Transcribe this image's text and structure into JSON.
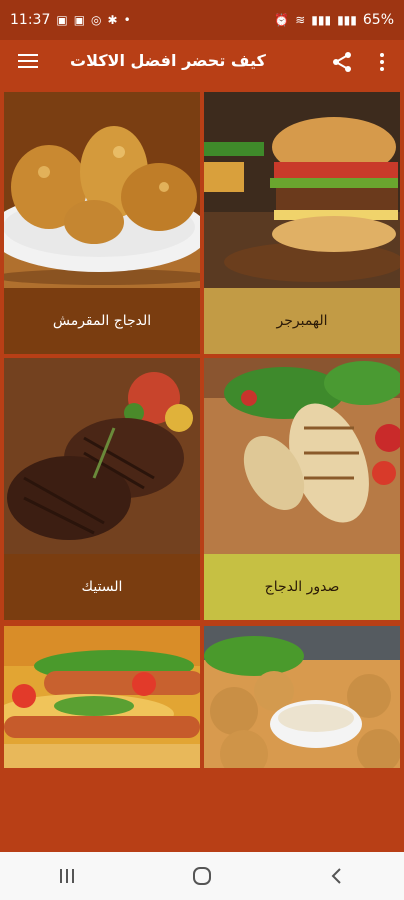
{
  "status_bar": {
    "time": "11:37",
    "battery": "65%"
  },
  "app_bar": {
    "title": "كيف تحضر افضل الاكلات",
    "icons": [
      "menu-icon",
      "share-icon",
      "more-vert-icon"
    ]
  },
  "recipes": [
    {
      "label": "الدجاج المقرمش"
    },
    {
      "label": "الهمبرجر"
    },
    {
      "label": "الستيك"
    },
    {
      "label": "صدور الدجاج"
    },
    {
      "label": ""
    },
    {
      "label": ""
    }
  ],
  "colors": {
    "primary": "#b83f16",
    "status_bar": "#9e3512",
    "caption_brown": "#7a3d10",
    "caption_gold": "#c29b45",
    "caption_yellow": "#c6c043"
  }
}
